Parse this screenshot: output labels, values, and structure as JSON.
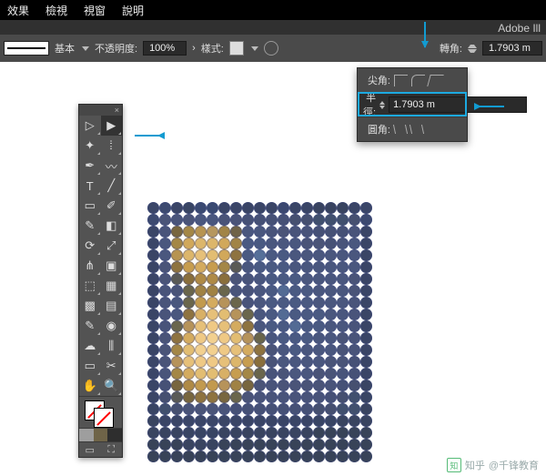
{
  "menu": {
    "items": [
      "效果",
      "檢視",
      "視窗",
      "說明"
    ]
  },
  "brand": "Adobe Ill",
  "optbar": {
    "stroke_preset": "基本",
    "opacity_label": "不透明度:",
    "opacity_value": "100%",
    "style_label": "樣式:",
    "turn_label": "轉角:",
    "turn_value": "1.7903 m"
  },
  "popover": {
    "row1_label": "尖角:",
    "row2_label": "半徑:",
    "row2_value": "1.7903 m",
    "row3_label": "圓角:"
  },
  "tools": {
    "rows": [
      [
        "selection",
        "▷",
        "direct-select",
        "▶"
      ],
      [
        "magic-wand",
        "✦",
        "lasso",
        "ⵂ"
      ],
      [
        "pen",
        "✒",
        "curvature",
        "〰"
      ],
      [
        "type",
        "T",
        "line",
        "╱"
      ],
      [
        "rect",
        "▭",
        "brush",
        "✐"
      ],
      [
        "shaper",
        "✎",
        "eraser",
        "◧"
      ],
      [
        "rotate",
        "⟳",
        "scale",
        "⤢"
      ],
      [
        "width",
        "⋔",
        "free-transform",
        "▣"
      ],
      [
        "shape-builder",
        "⬚",
        "perspective",
        "▦"
      ],
      [
        "mesh",
        "▩",
        "gradient",
        "▤"
      ],
      [
        "eyedropper",
        "✎",
        "blend",
        "◉"
      ],
      [
        "symbol-spray",
        "☁",
        "column-graph",
        "⫼"
      ],
      [
        "artboard",
        "▭",
        "slice",
        "✂"
      ],
      [
        "hand",
        "✋",
        "zoom",
        "🔍"
      ]
    ]
  },
  "watermark": {
    "site": "知乎",
    "author": "@千锋教育"
  },
  "mosaic_palette": [
    [
      "#3b4668",
      "#3d4a70",
      "#3a4566",
      "#394564",
      "#3b4a72",
      "#3a4a72",
      "#3a4566",
      "#3b4668",
      "#3a4566",
      "#3a4566",
      "#3a4566",
      "#3b4870",
      "#3a4566",
      "#3a4566",
      "#394460",
      "#394460",
      "#394460",
      "#3a4566",
      "#3b4668"
    ],
    [
      "#3d4a70",
      "#4a5478",
      "#49547a",
      "#4a5478",
      "#4a577e",
      "#4a577e",
      "#4a5478",
      "#4a5478",
      "#465176",
      "#465176",
      "#465176",
      "#465176",
      "#465070",
      "#465070",
      "#41506e",
      "#41506e",
      "#41506e",
      "#465070",
      "#3d4a70"
    ],
    [
      "#3a4566",
      "#49547a",
      "#78663f",
      "#a48746",
      "#b79451",
      "#b6975e",
      "#a18446",
      "#6f6348",
      "#4a577e",
      "#4a577e",
      "#49547a",
      "#4a5478",
      "#49547a",
      "#49547a",
      "#465176",
      "#465176",
      "#465176",
      "#49547a",
      "#3a4566"
    ],
    [
      "#3b4668",
      "#4a577e",
      "#a48746",
      "#d1a85a",
      "#dcb66b",
      "#dcb66b",
      "#d1a85a",
      "#a18446",
      "#4a5a82",
      "#4a5a82",
      "#4a577e",
      "#4a577e",
      "#4a577e",
      "#4a5478",
      "#4a5478",
      "#465176",
      "#49547a",
      "#4a577e",
      "#3a4566"
    ],
    [
      "#3a4566",
      "#4a577e",
      "#b79451",
      "#dcb66b",
      "#e6c079",
      "#e2bd72",
      "#d1a85a",
      "#8e7340",
      "#4a5a82",
      "#567099",
      "#4a5a82",
      "#4a5a82",
      "#4a577e",
      "#4a577e",
      "#4a577e",
      "#4a577e",
      "#4a577e",
      "#4a577e",
      "#3a4566"
    ],
    [
      "#3a4566",
      "#4a5478",
      "#8e7340",
      "#c79d4f",
      "#d4ab5f",
      "#c79d4f",
      "#a48746",
      "#5a5a56",
      "#4a577e",
      "#4a5a82",
      "#4a5a82",
      "#4a5a82",
      "#4a577e",
      "#4a577e",
      "#4a577e",
      "#4a577e",
      "#4a577e",
      "#4a577e",
      "#3a4566"
    ],
    [
      "#3a4566",
      "#4a5478",
      "#5a5a56",
      "#8a6f3c",
      "#af8a46",
      "#af8a46",
      "#8a6f3c",
      "#4a5478",
      "#49547a",
      "#4a577e",
      "#4a5a82",
      "#4a5a82",
      "#4a5a82",
      "#4a577e",
      "#4a577e",
      "#4a577e",
      "#4a577e",
      "#4a5478",
      "#3a4566"
    ],
    [
      "#3a4566",
      "#49547a",
      "#4a5478",
      "#6a664c",
      "#a08244",
      "#a08244",
      "#6a664c",
      "#49547a",
      "#49547a",
      "#4a577e",
      "#4a5a82",
      "#536b94",
      "#4a5a82",
      "#4a5a82",
      "#4a577e",
      "#4a577e",
      "#4a577e",
      "#4a5478",
      "#3a4566"
    ],
    [
      "#3a4566",
      "#49547a",
      "#4a577e",
      "#6a664c",
      "#c29a4e",
      "#d4ab5f",
      "#b6935a",
      "#6a664c",
      "#49547a",
      "#4a577e",
      "#4a5a82",
      "#4a5a82",
      "#4a5a82",
      "#4a5a82",
      "#4a577e",
      "#4a577e",
      "#4a577e",
      "#49547a",
      "#3a4566"
    ],
    [
      "#3a4566",
      "#49547a",
      "#4a577e",
      "#8e7340",
      "#d8b066",
      "#e6c079",
      "#e2bd72",
      "#b6935a",
      "#6a664c",
      "#4a577e",
      "#4a5a82",
      "#536b94",
      "#4a5a82",
      "#4a5a82",
      "#4a5a82",
      "#4a577e",
      "#4a577e",
      "#49547a",
      "#3a4566"
    ],
    [
      "#3a4566",
      "#49547a",
      "#6a664c",
      "#b6935a",
      "#e6c079",
      "#efc985",
      "#e6c079",
      "#d4ab5f",
      "#8e7340",
      "#4a577e",
      "#4a5a82",
      "#4a5a82",
      "#536b94",
      "#4a5a82",
      "#4a5a82",
      "#4a577e",
      "#4a577e",
      "#49547a",
      "#3a4566"
    ],
    [
      "#3a4566",
      "#4a5478",
      "#8e7340",
      "#d4ab5f",
      "#efc985",
      "#f2d08f",
      "#efc985",
      "#e2bd72",
      "#b6935a",
      "#6a664c",
      "#4a577e",
      "#4a5a82",
      "#4a5a82",
      "#4a5a82",
      "#4a577e",
      "#4a577e",
      "#4a5478",
      "#49547a",
      "#3a4566"
    ],
    [
      "#3a4566",
      "#4a5478",
      "#a48746",
      "#e2bd72",
      "#f2d08f",
      "#f2d08f",
      "#efc985",
      "#e6c079",
      "#d4ab5f",
      "#8e7340",
      "#4a5478",
      "#4a577e",
      "#4a5a82",
      "#4a577e",
      "#4a577e",
      "#4a577e",
      "#4a5478",
      "#49547a",
      "#3a4566"
    ],
    [
      "#3b4668",
      "#4a5478",
      "#b6935a",
      "#e6c079",
      "#efc985",
      "#efc985",
      "#e6c079",
      "#dcb66b",
      "#c79d4f",
      "#8a6f3c",
      "#4a5478",
      "#4a577e",
      "#4a577e",
      "#4a577e",
      "#4a577e",
      "#4a5478",
      "#4a5478",
      "#465176",
      "#3a4566"
    ],
    [
      "#3b4668",
      "#49547a",
      "#a48746",
      "#d4ab5f",
      "#e2bd72",
      "#e2bd72",
      "#d8b066",
      "#c79d4f",
      "#a48746",
      "#6a664c",
      "#49547a",
      "#4a5478",
      "#4a577e",
      "#4a577e",
      "#4a5478",
      "#4a5478",
      "#49547a",
      "#465176",
      "#3a4566"
    ],
    [
      "#3a4566",
      "#465176",
      "#78663f",
      "#af8a46",
      "#c29a4e",
      "#c29a4e",
      "#b6935a",
      "#a08244",
      "#78663f",
      "#4a5478",
      "#49547a",
      "#4a5478",
      "#4a5478",
      "#4a5478",
      "#4a5478",
      "#49547a",
      "#465176",
      "#465070",
      "#394564"
    ],
    [
      "#3a4566",
      "#465070",
      "#5a5a56",
      "#78663f",
      "#8e7340",
      "#8e7340",
      "#78663f",
      "#6a664c",
      "#4a5478",
      "#49547a",
      "#49547a",
      "#49547a",
      "#49547a",
      "#49547a",
      "#49547a",
      "#465176",
      "#465070",
      "#41506e",
      "#394564"
    ],
    [
      "#394564",
      "#41506e",
      "#465070",
      "#4a5478",
      "#4a5478",
      "#4a5478",
      "#49547a",
      "#465176",
      "#465176",
      "#465176",
      "#465176",
      "#465176",
      "#465176",
      "#465176",
      "#465070",
      "#465070",
      "#41506e",
      "#41506e",
      "#394460"
    ],
    [
      "#394460",
      "#3a4566",
      "#3a4566",
      "#3b4668",
      "#3b4668",
      "#3b4668",
      "#3a4566",
      "#3a4566",
      "#3a4566",
      "#3a4566",
      "#3a4566",
      "#3a4566",
      "#3a4566",
      "#3a4566",
      "#394564",
      "#394564",
      "#394460",
      "#394460",
      "#394460"
    ],
    [
      "#394460",
      "#394460",
      "#394460",
      "#394564",
      "#394564",
      "#394564",
      "#394460",
      "#394460",
      "#394460",
      "#394460",
      "#394460",
      "#394460",
      "#394460",
      "#394460",
      "#384358",
      "#384358",
      "#384358",
      "#384358",
      "#384358"
    ],
    [
      "#384358",
      "#384358",
      "#384358",
      "#394460",
      "#394460",
      "#394460",
      "#384358",
      "#384358",
      "#384358",
      "#384358",
      "#384358",
      "#384358",
      "#384358",
      "#384358",
      "#384358",
      "#384358",
      "#384358",
      "#384358",
      "#384358"
    ],
    [
      "#384358",
      "#384358",
      "#384358",
      "#384358",
      "#384358",
      "#384358",
      "#384358",
      "#384358",
      "#384358",
      "#384358",
      "#384358",
      "#384358",
      "#384358",
      "#384358",
      "#384358",
      "#384358",
      "#384358",
      "#384358",
      "#384358"
    ]
  ]
}
